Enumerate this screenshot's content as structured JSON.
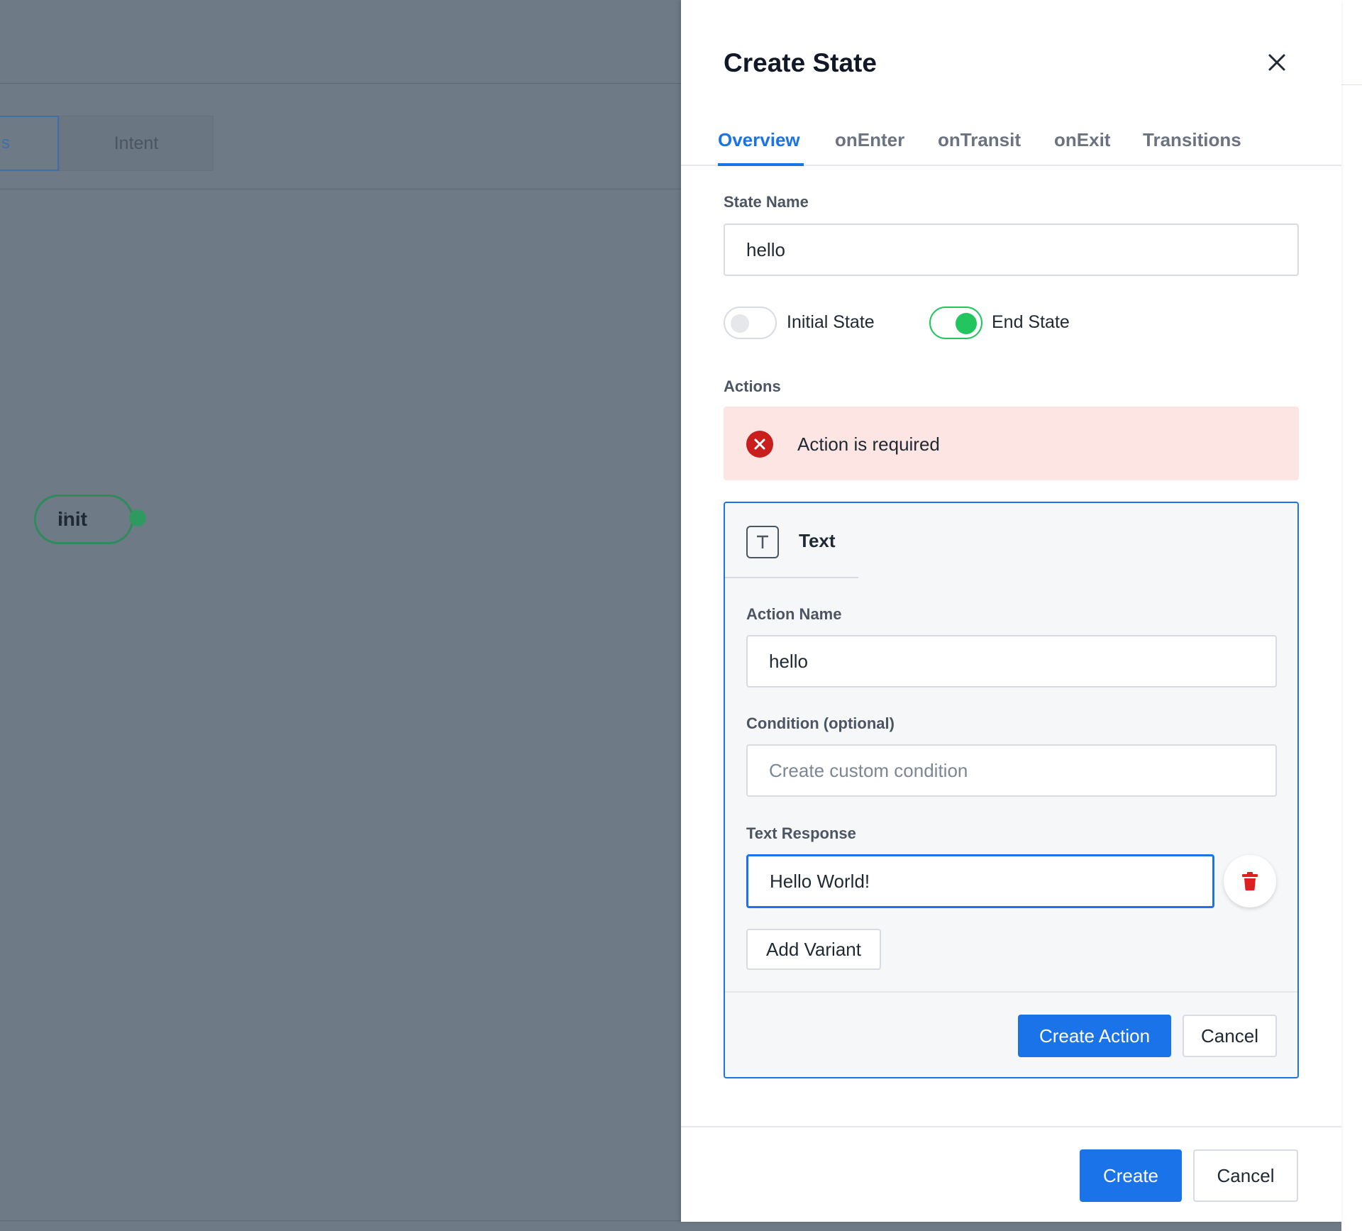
{
  "background": {
    "tabs": [
      {
        "label": "s"
      },
      {
        "label": "Intent"
      }
    ],
    "node": {
      "label": "init"
    }
  },
  "panel": {
    "title": "Create State",
    "tabs": [
      {
        "label": "Overview",
        "active": true
      },
      {
        "label": "onEnter"
      },
      {
        "label": "onTransit"
      },
      {
        "label": "onExit"
      },
      {
        "label": "Transitions"
      }
    ],
    "state_name": {
      "label": "State Name",
      "value": "hello"
    },
    "toggles": {
      "initial_state": {
        "label": "Initial State",
        "on": false
      },
      "end_state": {
        "label": "End State",
        "on": true
      }
    },
    "actions_label": "Actions",
    "alert": {
      "text": "Action is required"
    },
    "action_card": {
      "type": "Text",
      "action_name": {
        "label": "Action Name",
        "value": "hello"
      },
      "condition": {
        "label": "Condition (optional)",
        "placeholder": "Create custom condition"
      },
      "text_response": {
        "label": "Text Response",
        "value": "Hello World!"
      },
      "add_variant_label": "Add Variant",
      "create_action_label": "Create Action",
      "cancel_label": "Cancel"
    },
    "footer": {
      "create_label": "Create",
      "cancel_label": "Cancel"
    }
  },
  "colors": {
    "accent": "#1a73e8",
    "success": "#22c55e",
    "danger": "#c81e1e",
    "overlay": "#6e7a86"
  }
}
